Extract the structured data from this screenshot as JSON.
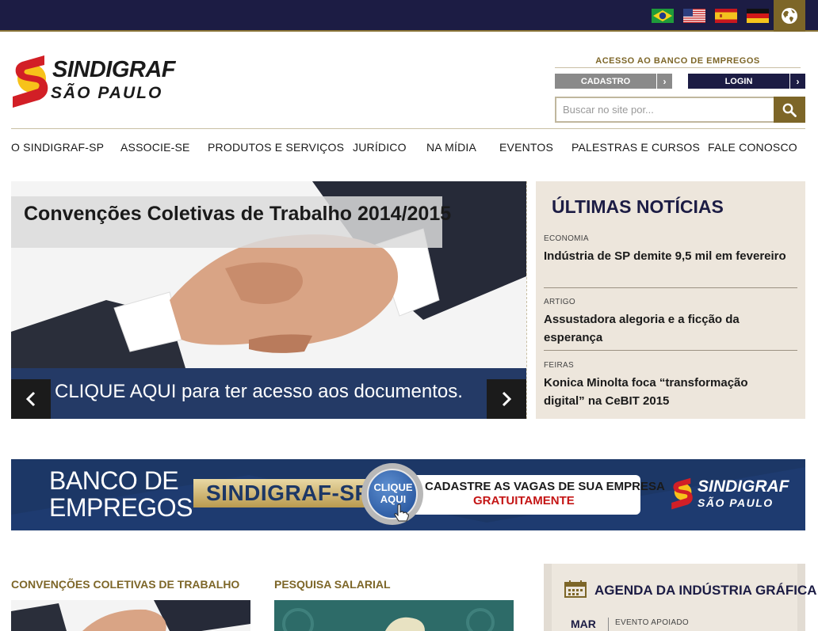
{
  "colors": {
    "navy": "#1c1c44",
    "gold": "#7d6628",
    "beige_panel": "#ede6dc",
    "banner_blue": "#1c3766",
    "accent_red": "#c41515"
  },
  "topbar": {
    "languages": [
      {
        "name": "brazil-flag-icon"
      },
      {
        "name": "usa-flag-icon"
      },
      {
        "name": "spain-flag-icon"
      },
      {
        "name": "germany-flag-icon"
      }
    ],
    "globe_icon": "globe-icon"
  },
  "logo": {
    "line1": "SINDIGRAF",
    "line2": "SÃO PAULO"
  },
  "access": {
    "title": "ACESSO AO BANCO DE EMPREGOS",
    "register_label": "CADASTRO",
    "login_label": "LOGIN",
    "arrow": "›"
  },
  "search": {
    "placeholder": "Buscar no site por..."
  },
  "nav": {
    "items": [
      "O SINDIGRAF-SP",
      "ASSOCIE-SE",
      "PRODUTOS E SERVIÇOS",
      "JURÍDICO",
      "NA MÍDIA",
      "EVENTOS",
      "PALESTRAS E CURSOS",
      "FALE CONOSCO"
    ]
  },
  "slider": {
    "title": "Convenções Coletivas de Trabalho 2014/2015",
    "cta": "CLIQUE AQUI para ter acesso aos documentos."
  },
  "news": {
    "title": "ÚLTIMAS NOTÍCIAS",
    "items": [
      {
        "category": "ECONOMIA",
        "headline": "Indústria de SP demite 9,5 mil em fevereiro"
      },
      {
        "category": "ARTIGO",
        "headline": "Assustadora alegoria e a ficção da esperança"
      },
      {
        "category": "FEIRAS",
        "headline": "Konica Minolta foca “transformação digital” na CeBIT 2015"
      }
    ]
  },
  "banner": {
    "left_line1": "BANCO DE",
    "left_line2": "EMPREGOS",
    "brand": "SINDIGRAF-SP",
    "button_line1": "CLIQUE",
    "button_line2": "AQUI",
    "msg_line1": "CADASTRE AS VAGAS DE SUA EMPRESA",
    "msg_line2": "GRATUITAMENTE",
    "logo_line1": "SINDIGRAF",
    "logo_line2": "SÃO PAULO"
  },
  "sections": {
    "conventions_title": "CONVENÇÕES COLETIVAS DE TRABALHO",
    "salary_title": "PESQUISA SALARIAL"
  },
  "agenda": {
    "title": "AGENDA DA INDÚSTRIA GRÁFICA",
    "month": "MAR",
    "tag": "EVENTO APOIADO"
  }
}
